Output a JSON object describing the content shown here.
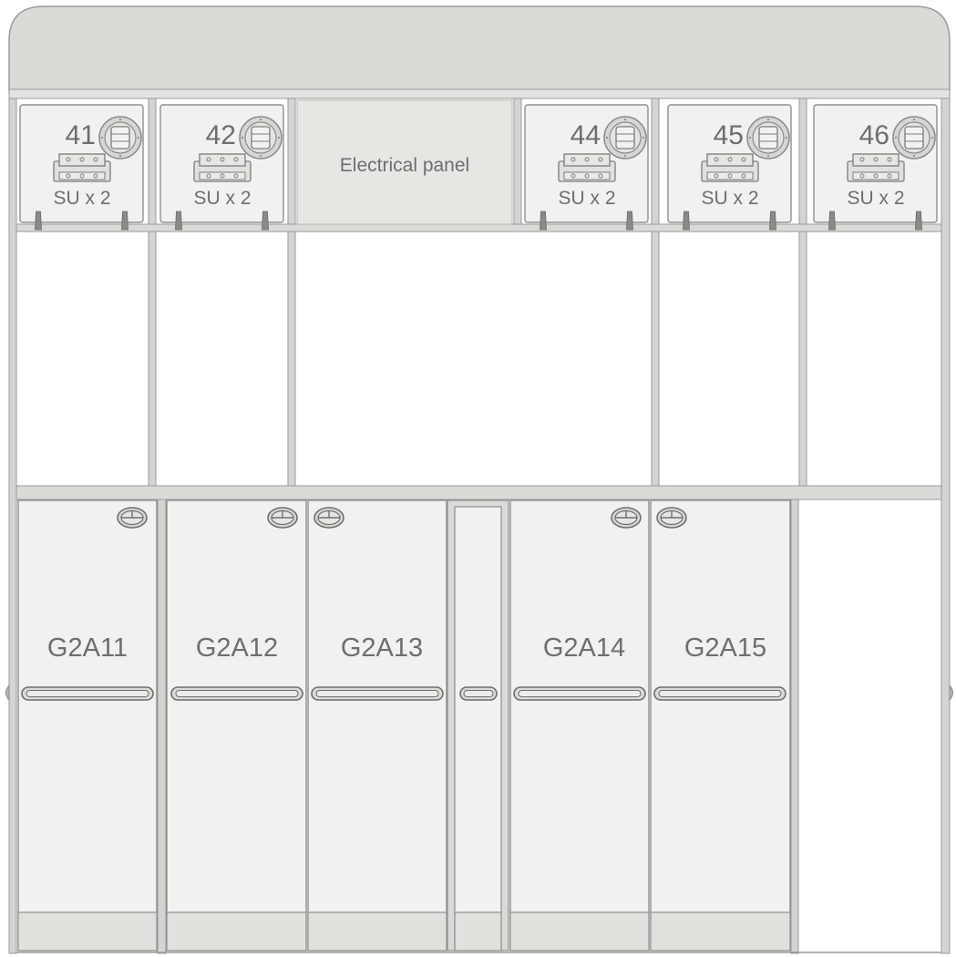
{
  "upper_compartments": [
    {
      "number": "41",
      "tag": "SU x 2"
    },
    {
      "number": "42",
      "tag": "SU x 2"
    },
    {
      "number": "44",
      "tag": "SU x 2"
    },
    {
      "number": "45",
      "tag": "SU x 2"
    },
    {
      "number": "46",
      "tag": "SU x 2"
    }
  ],
  "electrical_panel": {
    "label": "Electrical panel"
  },
  "carts": [
    {
      "label": "G2A11"
    },
    {
      "label": "G2A12"
    },
    {
      "label": "G2A13"
    },
    {
      "label": "G2A14"
    },
    {
      "label": "G2A15"
    }
  ],
  "colors": {
    "frame": "#c9c7c4",
    "frame_stroke": "#8f8f8f",
    "crown": "#dcdad7",
    "panel": "#f2f1ef",
    "text": "#6e6e6e"
  }
}
